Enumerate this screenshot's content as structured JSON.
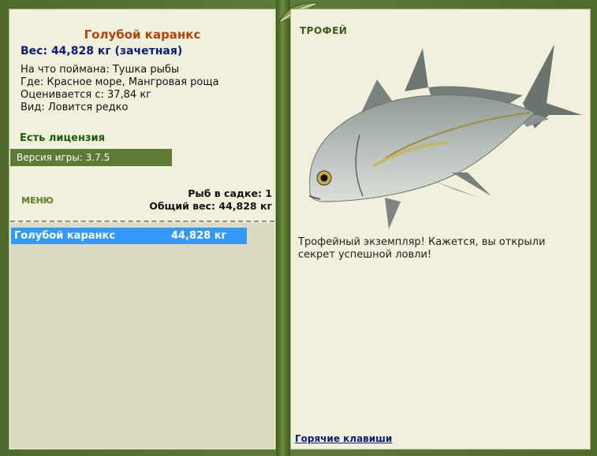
{
  "fish": {
    "name": "Голубой каранкс",
    "weight_line": "Вес: 44,828 кг (зачетная)",
    "bait_line": "На что поймана: Тушка рыбы",
    "location_line": "Где: Красное море, Мангровая роща",
    "value_line": "Оценивается с: 37,84 кг",
    "rarity_line": "Вид: Ловится редко"
  },
  "license": "Есть лицензия",
  "version": "Версия игры: 3.7.5",
  "menu_label": "МЕНЮ",
  "cage": {
    "count_line": "Рыб в садке: 1",
    "total_line": "Общий вес: 44,828 кг"
  },
  "catch_list": [
    {
      "name": "Голубой каранкс",
      "weight": "44,828 кг"
    }
  ],
  "trophy": {
    "label": "ТРОФЕЙ",
    "message": "Трофейный экземпляр! Кажется, вы открыли секрет успешной ловли!"
  },
  "hotkeys_link": "Горячие клавиши",
  "colors": {
    "frame": "#56722f",
    "panel": "#f1f0dc",
    "title": "#b4420a",
    "weight": "#0c1d78",
    "selection": "#3399ff"
  }
}
